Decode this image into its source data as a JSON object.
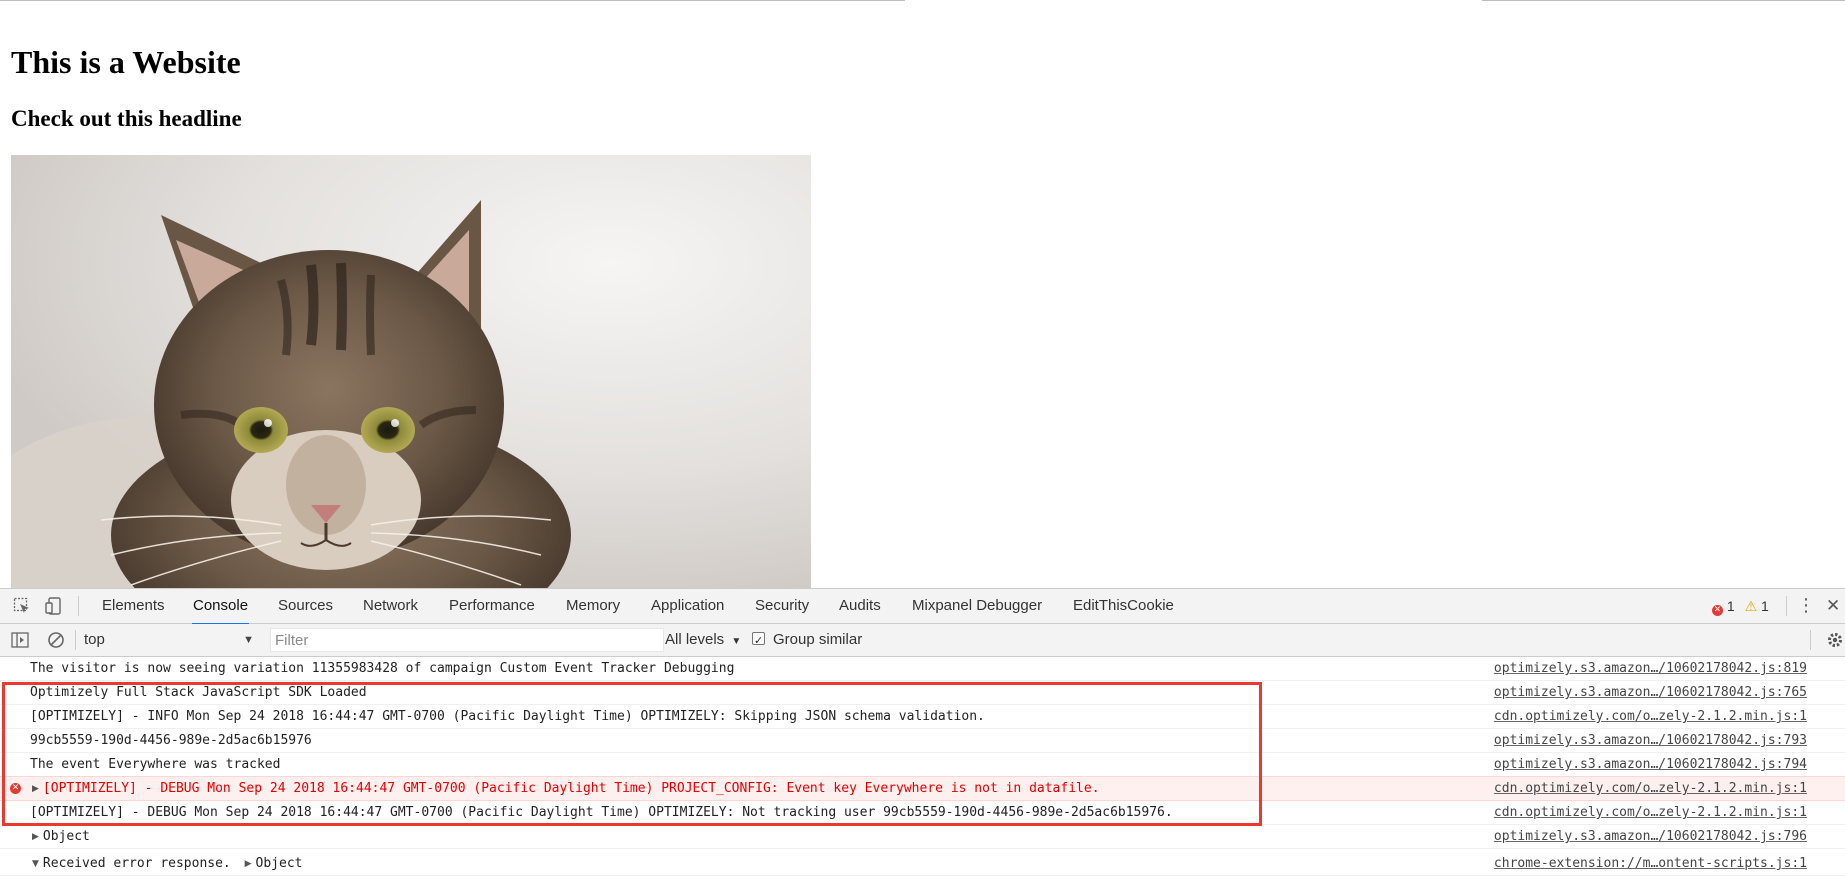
{
  "page": {
    "heading": "This is a Website",
    "subheading": "Check out this headline"
  },
  "devtools": {
    "tabs": [
      {
        "label": "Elements"
      },
      {
        "label": "Console"
      },
      {
        "label": "Sources"
      },
      {
        "label": "Network"
      },
      {
        "label": "Performance"
      },
      {
        "label": "Memory"
      },
      {
        "label": "Application"
      },
      {
        "label": "Security"
      },
      {
        "label": "Audits"
      },
      {
        "label": "Mixpanel Debugger"
      },
      {
        "label": "EditThisCookie"
      }
    ],
    "active_tab": "Console",
    "error_count": "1",
    "warning_count": "1",
    "toolbar": {
      "context": "top",
      "filter_placeholder": "Filter",
      "levels": "All levels",
      "group_similar": "Group similar"
    },
    "console_rows": [
      {
        "msg": "The visitor is now seeing variation 11355983428 of campaign Custom Event Tracker Debugging",
        "src": "optimizely.s3.amazon…/10602178042.js:819"
      },
      {
        "msg": "Optimizely Full Stack JavaScript SDK Loaded",
        "src": "optimizely.s3.amazon…/10602178042.js:765"
      },
      {
        "msg": "[OPTIMIZELY] - INFO Mon Sep 24 2018 16:44:47 GMT-0700 (Pacific Daylight Time) OPTIMIZELY: Skipping JSON schema validation.",
        "src": "cdn.optimizely.com/o…zely-2.1.2.min.js:1"
      },
      {
        "msg": "99cb5559-190d-4456-989e-2d5ac6b15976",
        "src": "optimizely.s3.amazon…/10602178042.js:793"
      },
      {
        "msg": "The event Everywhere was tracked",
        "src": "optimizely.s3.amazon…/10602178042.js:794"
      },
      {
        "msg": "[OPTIMIZELY] - DEBUG Mon Sep 24 2018 16:44:47 GMT-0700 (Pacific Daylight Time) PROJECT_CONFIG: Event key Everywhere is not in datafile.",
        "src": "cdn.optimizely.com/o…zely-2.1.2.min.js:1"
      },
      {
        "msg": "[OPTIMIZELY] - DEBUG Mon Sep 24 2018 16:44:47 GMT-0700 (Pacific Daylight Time) OPTIMIZELY: Not tracking user 99cb5559-190d-4456-989e-2d5ac6b15976.",
        "src": "cdn.optimizely.com/o…zely-2.1.2.min.js:1"
      },
      {
        "msg": "Object",
        "src": "optimizely.s3.amazon…/10602178042.js:796"
      },
      {
        "msg": "Received error response.",
        "msg_suffix": "Object",
        "src": "chrome-extension://m…ontent-scripts.js:1"
      }
    ]
  },
  "colors": {
    "accent": "#1a73e8",
    "error_text": "#e00000",
    "error_bg": "#fff0f0",
    "highlight_border": "#e83a2e"
  },
  "icons": {
    "photo": "cat-photo",
    "inspect": "inspect-element-icon",
    "device": "device-toolbar-icon",
    "menu": "kebab-menu-icon",
    "close": "close-icon",
    "sidebar": "console-sidebar-icon",
    "clear": "clear-console-icon",
    "settings": "gear-icon"
  }
}
